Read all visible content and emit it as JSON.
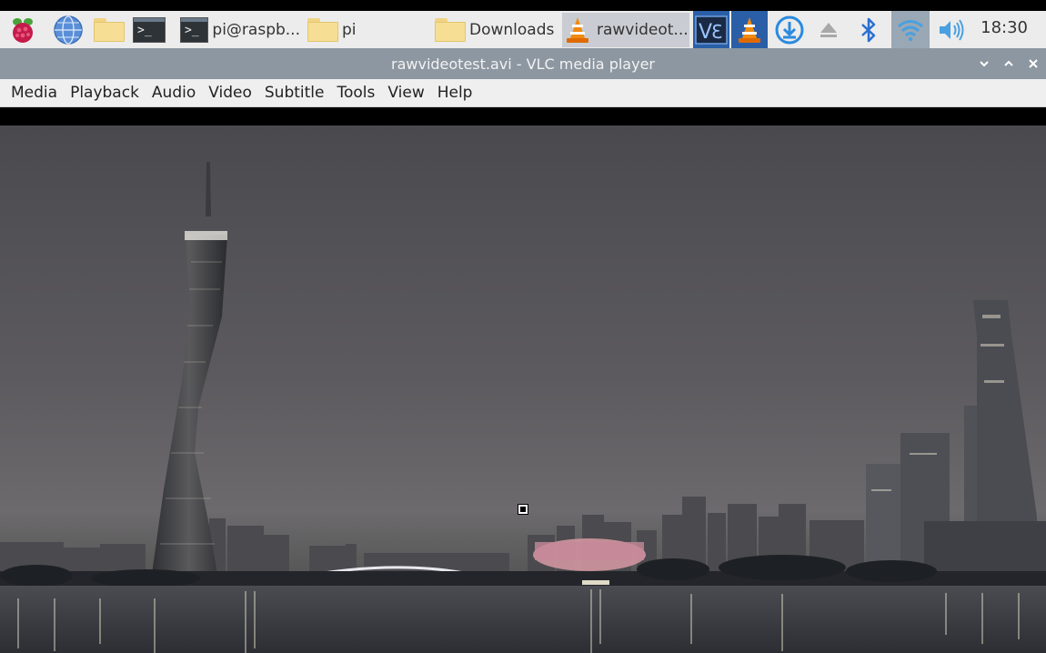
{
  "taskbar": {
    "tasks": [
      {
        "label": "pi@raspb..."
      },
      {
        "label": "pi"
      },
      {
        "label": "Downloads"
      },
      {
        "label": "rawvideot..."
      }
    ],
    "clock": "18:30"
  },
  "window": {
    "title": "rawvideotest.avi - VLC media player"
  },
  "menu": {
    "items": [
      "Media",
      "Playback",
      "Audio",
      "Video",
      "Subtitle",
      "Tools",
      "View",
      "Help"
    ]
  },
  "icons": {
    "launcher": [
      "raspberry-menu-icon",
      "web-browser-icon",
      "file-manager-icon",
      "terminal-icon"
    ],
    "tray": [
      "vnc-icon",
      "vlc-tray-icon",
      "updater-icon",
      "eject-icon",
      "bluetooth-icon",
      "wifi-icon",
      "volume-icon"
    ]
  },
  "colors": {
    "taskbar_bg": "#ececec",
    "titlebar_bg": "#8d97a1",
    "vlc_orange": "#f08a10",
    "active_tray_bg": "#2a5fa8"
  }
}
